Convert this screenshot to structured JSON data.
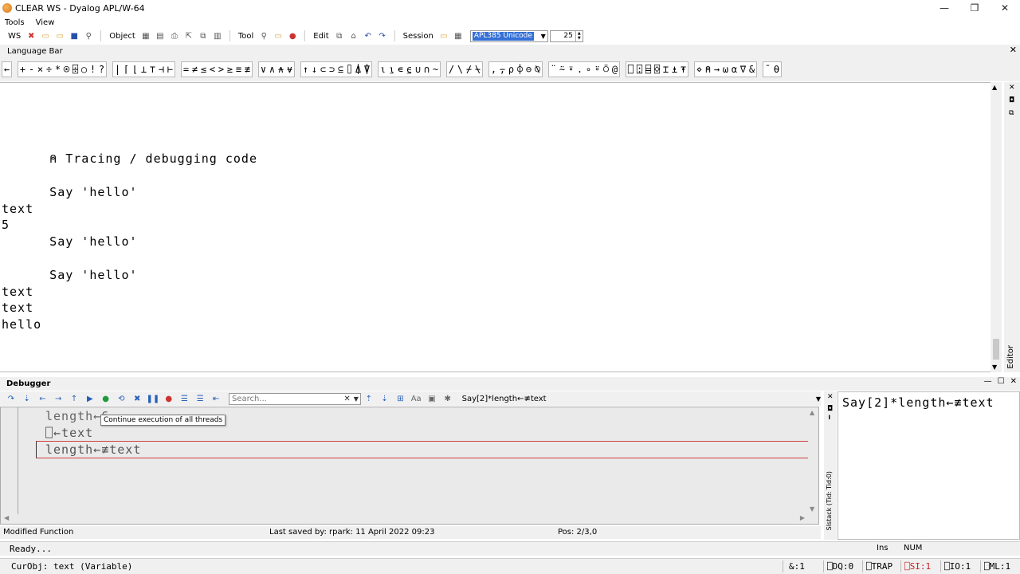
{
  "window": {
    "title": "CLEAR WS - Dyalog APL/W-64",
    "controls": {
      "minimize": "—",
      "restore": "❐",
      "close": "✕"
    }
  },
  "menu": [
    "Tools",
    "View"
  ],
  "toolbar": {
    "ws_label": "WS",
    "object_label": "Object",
    "tool_label": "Tool",
    "edit_label": "Edit",
    "session_label": "Session",
    "font_value": "APL385 Unicode",
    "font_size": "25"
  },
  "language_bar": {
    "title": "Language Bar",
    "groups": [
      [
        "←"
      ],
      [
        "+",
        "-",
        "×",
        "÷",
        "*",
        "⍟",
        "⌹",
        "○",
        "!",
        "?"
      ],
      [
        "|",
        "⌈",
        "⌊",
        "⊥",
        "⊤",
        "⊣",
        "⊢"
      ],
      [
        "=",
        "≠",
        "≤",
        "<",
        ">",
        "≥",
        "≡",
        "≢"
      ],
      [
        "∨",
        "∧",
        "⍲",
        "⍱"
      ],
      [
        "↑",
        "↓",
        "⊂",
        "⊃",
        "⊆",
        "⌷",
        "⍋",
        "⍒"
      ],
      [
        "⍳",
        "⍸",
        "∊",
        "⍷",
        "∪",
        "∩",
        "~"
      ],
      [
        "/",
        "\\",
        "⌿",
        "⍀"
      ],
      [
        ",",
        "⍪",
        "⍴",
        "⌽",
        "⊖",
        "⍉"
      ],
      [
        "¨",
        "⍨",
        "⍣",
        ".",
        "∘",
        "⍤",
        "⍥",
        "@"
      ],
      [
        "⎕",
        "⍠",
        "⌸",
        "⌺",
        "⌶",
        "⍎",
        "⍕"
      ],
      [
        "⋄",
        "⍝",
        "→",
        "⍵",
        "⍺",
        "∇",
        "&"
      ],
      [
        "¯",
        "⍬"
      ]
    ]
  },
  "session": {
    "lines": [
      {
        "text": "      ⍝ Tracing / debugging code",
        "row": 4
      },
      {
        "text": "      Say 'hello'",
        "row": 6
      },
      {
        "text": "text",
        "row": 7
      },
      {
        "text": "5",
        "row": 8
      },
      {
        "text": "      Say 'hello'",
        "row": 9
      },
      {
        "text": "      Say 'hello'",
        "row": 11
      },
      {
        "text": "text",
        "row": 12
      },
      {
        "text": "text",
        "row": 13
      },
      {
        "text": "hello",
        "row": 14
      }
    ],
    "editor_label": "Editor"
  },
  "debugger": {
    "title": "Debugger",
    "search_placeholder": "Search...",
    "function_selector": "Say[2]*length←≢text",
    "tooltip": "Continue execution of all threads",
    "code_lines": [
      "length←6",
      "⎕←text",
      "length←≢text"
    ],
    "sistack_label": "SIstack (Tid: Tid:0)",
    "sistack_entry": "Say[2]*length←≢text",
    "status": {
      "left": "Modified Function",
      "middle": "Last saved by: rpark: 11 April 2022 09:23",
      "right": "Pos: 2/3,0"
    }
  },
  "statusbar": {
    "ready": "Ready...",
    "ins": "Ins",
    "num": "NUM",
    "curobj": "CurObj: text (Variable)",
    "amp": "&:1",
    "dq": "⎕DQ:0",
    "trap": "⎕TRAP",
    "si": "⎕SI:1",
    "io": "⎕IO:1",
    "ml": "⎕ML:1",
    "si_color": "#d02020"
  }
}
